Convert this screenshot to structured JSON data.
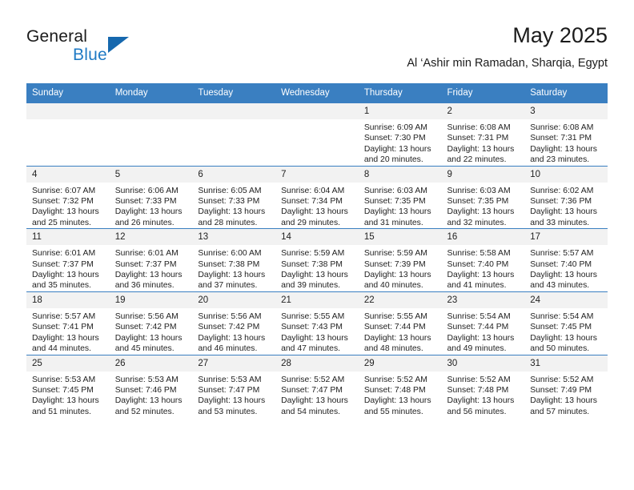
{
  "brand": {
    "word1": "General",
    "word2": "Blue",
    "accent_color": "#1f7ac4",
    "triangle_color": "#1668ae"
  },
  "header": {
    "title": "May 2025",
    "subtitle": "Al ‘Ashir min Ramadan, Sharqia, Egypt"
  },
  "calendar": {
    "header_bg": "#3a7fc1",
    "header_text_color": "#ffffff",
    "daynum_bg": "#f2f2f2",
    "weekdays": [
      "Sunday",
      "Monday",
      "Tuesday",
      "Wednesday",
      "Thursday",
      "Friday",
      "Saturday"
    ],
    "weeks": [
      [
        {
          "day": "",
          "empty": true
        },
        {
          "day": "",
          "empty": true
        },
        {
          "day": "",
          "empty": true
        },
        {
          "day": "",
          "empty": true
        },
        {
          "day": "1",
          "sunrise": "Sunrise: 6:09 AM",
          "sunset": "Sunset: 7:30 PM",
          "daylight1": "Daylight: 13 hours",
          "daylight2": "and 20 minutes."
        },
        {
          "day": "2",
          "sunrise": "Sunrise: 6:08 AM",
          "sunset": "Sunset: 7:31 PM",
          "daylight1": "Daylight: 13 hours",
          "daylight2": "and 22 minutes."
        },
        {
          "day": "3",
          "sunrise": "Sunrise: 6:08 AM",
          "sunset": "Sunset: 7:31 PM",
          "daylight1": "Daylight: 13 hours",
          "daylight2": "and 23 minutes."
        }
      ],
      [
        {
          "day": "4",
          "sunrise": "Sunrise: 6:07 AM",
          "sunset": "Sunset: 7:32 PM",
          "daylight1": "Daylight: 13 hours",
          "daylight2": "and 25 minutes."
        },
        {
          "day": "5",
          "sunrise": "Sunrise: 6:06 AM",
          "sunset": "Sunset: 7:33 PM",
          "daylight1": "Daylight: 13 hours",
          "daylight2": "and 26 minutes."
        },
        {
          "day": "6",
          "sunrise": "Sunrise: 6:05 AM",
          "sunset": "Sunset: 7:33 PM",
          "daylight1": "Daylight: 13 hours",
          "daylight2": "and 28 minutes."
        },
        {
          "day": "7",
          "sunrise": "Sunrise: 6:04 AM",
          "sunset": "Sunset: 7:34 PM",
          "daylight1": "Daylight: 13 hours",
          "daylight2": "and 29 minutes."
        },
        {
          "day": "8",
          "sunrise": "Sunrise: 6:03 AM",
          "sunset": "Sunset: 7:35 PM",
          "daylight1": "Daylight: 13 hours",
          "daylight2": "and 31 minutes."
        },
        {
          "day": "9",
          "sunrise": "Sunrise: 6:03 AM",
          "sunset": "Sunset: 7:35 PM",
          "daylight1": "Daylight: 13 hours",
          "daylight2": "and 32 minutes."
        },
        {
          "day": "10",
          "sunrise": "Sunrise: 6:02 AM",
          "sunset": "Sunset: 7:36 PM",
          "daylight1": "Daylight: 13 hours",
          "daylight2": "and 33 minutes."
        }
      ],
      [
        {
          "day": "11",
          "sunrise": "Sunrise: 6:01 AM",
          "sunset": "Sunset: 7:37 PM",
          "daylight1": "Daylight: 13 hours",
          "daylight2": "and 35 minutes."
        },
        {
          "day": "12",
          "sunrise": "Sunrise: 6:01 AM",
          "sunset": "Sunset: 7:37 PM",
          "daylight1": "Daylight: 13 hours",
          "daylight2": "and 36 minutes."
        },
        {
          "day": "13",
          "sunrise": "Sunrise: 6:00 AM",
          "sunset": "Sunset: 7:38 PM",
          "daylight1": "Daylight: 13 hours",
          "daylight2": "and 37 minutes."
        },
        {
          "day": "14",
          "sunrise": "Sunrise: 5:59 AM",
          "sunset": "Sunset: 7:38 PM",
          "daylight1": "Daylight: 13 hours",
          "daylight2": "and 39 minutes."
        },
        {
          "day": "15",
          "sunrise": "Sunrise: 5:59 AM",
          "sunset": "Sunset: 7:39 PM",
          "daylight1": "Daylight: 13 hours",
          "daylight2": "and 40 minutes."
        },
        {
          "day": "16",
          "sunrise": "Sunrise: 5:58 AM",
          "sunset": "Sunset: 7:40 PM",
          "daylight1": "Daylight: 13 hours",
          "daylight2": "and 41 minutes."
        },
        {
          "day": "17",
          "sunrise": "Sunrise: 5:57 AM",
          "sunset": "Sunset: 7:40 PM",
          "daylight1": "Daylight: 13 hours",
          "daylight2": "and 43 minutes."
        }
      ],
      [
        {
          "day": "18",
          "sunrise": "Sunrise: 5:57 AM",
          "sunset": "Sunset: 7:41 PM",
          "daylight1": "Daylight: 13 hours",
          "daylight2": "and 44 minutes."
        },
        {
          "day": "19",
          "sunrise": "Sunrise: 5:56 AM",
          "sunset": "Sunset: 7:42 PM",
          "daylight1": "Daylight: 13 hours",
          "daylight2": "and 45 minutes."
        },
        {
          "day": "20",
          "sunrise": "Sunrise: 5:56 AM",
          "sunset": "Sunset: 7:42 PM",
          "daylight1": "Daylight: 13 hours",
          "daylight2": "and 46 minutes."
        },
        {
          "day": "21",
          "sunrise": "Sunrise: 5:55 AM",
          "sunset": "Sunset: 7:43 PM",
          "daylight1": "Daylight: 13 hours",
          "daylight2": "and 47 minutes."
        },
        {
          "day": "22",
          "sunrise": "Sunrise: 5:55 AM",
          "sunset": "Sunset: 7:44 PM",
          "daylight1": "Daylight: 13 hours",
          "daylight2": "and 48 minutes."
        },
        {
          "day": "23",
          "sunrise": "Sunrise: 5:54 AM",
          "sunset": "Sunset: 7:44 PM",
          "daylight1": "Daylight: 13 hours",
          "daylight2": "and 49 minutes."
        },
        {
          "day": "24",
          "sunrise": "Sunrise: 5:54 AM",
          "sunset": "Sunset: 7:45 PM",
          "daylight1": "Daylight: 13 hours",
          "daylight2": "and 50 minutes."
        }
      ],
      [
        {
          "day": "25",
          "sunrise": "Sunrise: 5:53 AM",
          "sunset": "Sunset: 7:45 PM",
          "daylight1": "Daylight: 13 hours",
          "daylight2": "and 51 minutes."
        },
        {
          "day": "26",
          "sunrise": "Sunrise: 5:53 AM",
          "sunset": "Sunset: 7:46 PM",
          "daylight1": "Daylight: 13 hours",
          "daylight2": "and 52 minutes."
        },
        {
          "day": "27",
          "sunrise": "Sunrise: 5:53 AM",
          "sunset": "Sunset: 7:47 PM",
          "daylight1": "Daylight: 13 hours",
          "daylight2": "and 53 minutes."
        },
        {
          "day": "28",
          "sunrise": "Sunrise: 5:52 AM",
          "sunset": "Sunset: 7:47 PM",
          "daylight1": "Daylight: 13 hours",
          "daylight2": "and 54 minutes."
        },
        {
          "day": "29",
          "sunrise": "Sunrise: 5:52 AM",
          "sunset": "Sunset: 7:48 PM",
          "daylight1": "Daylight: 13 hours",
          "daylight2": "and 55 minutes."
        },
        {
          "day": "30",
          "sunrise": "Sunrise: 5:52 AM",
          "sunset": "Sunset: 7:48 PM",
          "daylight1": "Daylight: 13 hours",
          "daylight2": "and 56 minutes."
        },
        {
          "day": "31",
          "sunrise": "Sunrise: 5:52 AM",
          "sunset": "Sunset: 7:49 PM",
          "daylight1": "Daylight: 13 hours",
          "daylight2": "and 57 minutes."
        }
      ]
    ]
  }
}
